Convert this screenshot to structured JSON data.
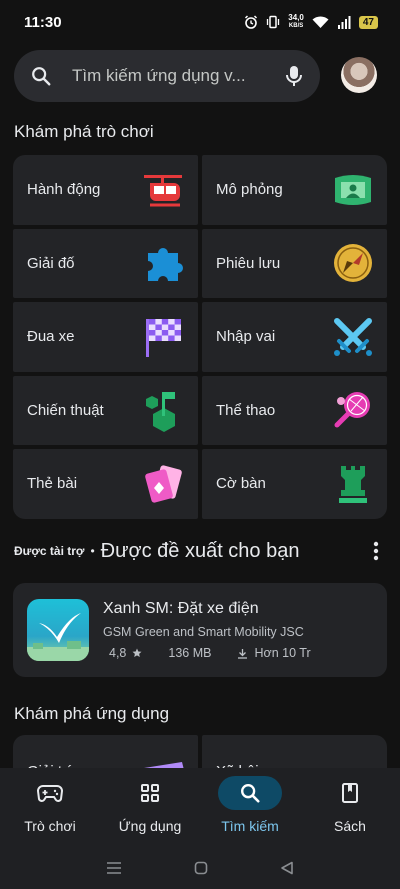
{
  "status": {
    "time": "11:30",
    "net_speed": "34,0",
    "net_unit": "KB/S",
    "battery": "47"
  },
  "search": {
    "placeholder": "Tìm kiếm ứng dụng v..."
  },
  "games_section": {
    "title": "Khám phá trò chơi",
    "categories": [
      {
        "label": "Hành động",
        "icon": "helicopter-icon"
      },
      {
        "label": "Mô phỏng",
        "icon": "simulation-icon"
      },
      {
        "label": "Giải đố",
        "icon": "puzzle-icon"
      },
      {
        "label": "Phiêu lưu",
        "icon": "compass-icon"
      },
      {
        "label": "Đua xe",
        "icon": "checkered-flag-icon"
      },
      {
        "label": "Nhập vai",
        "icon": "crossed-swords-icon"
      },
      {
        "label": "Chiến thuật",
        "icon": "strategy-flag-icon"
      },
      {
        "label": "Thể thao",
        "icon": "tennis-racket-icon"
      },
      {
        "label": "Thẻ bài",
        "icon": "cards-icon"
      },
      {
        "label": "Cờ bàn",
        "icon": "chess-rook-icon"
      }
    ]
  },
  "sponsored": {
    "tag": "Được tài trợ",
    "separator": "•",
    "title": "Được đề xuất cho bạn",
    "app": {
      "name": "Xanh SM: Đặt xe điện",
      "developer": "GSM Green and Smart Mobility JSC",
      "rating": "4,8",
      "size": "136 MB",
      "downloads": "Hơn 10 Tr"
    }
  },
  "apps_section": {
    "title": "Khám phá ứng dụng",
    "categories": [
      {
        "label": "Giải trí",
        "icon": "clapperboard-icon"
      },
      {
        "label": "Xã hội",
        "icon": "social-icon"
      }
    ]
  },
  "bottom_nav": [
    {
      "label": "Trò chơi",
      "icon": "gamepad-icon"
    },
    {
      "label": "Ứng dụng",
      "icon": "apps-grid-icon"
    },
    {
      "label": "Tìm kiếm",
      "icon": "search-icon",
      "active": true
    },
    {
      "label": "Sách",
      "icon": "book-icon"
    }
  ],
  "colors": {
    "background": "#121212",
    "card": "#232427",
    "accent": "#7cc6ee",
    "active_pill": "#0e4a66"
  }
}
